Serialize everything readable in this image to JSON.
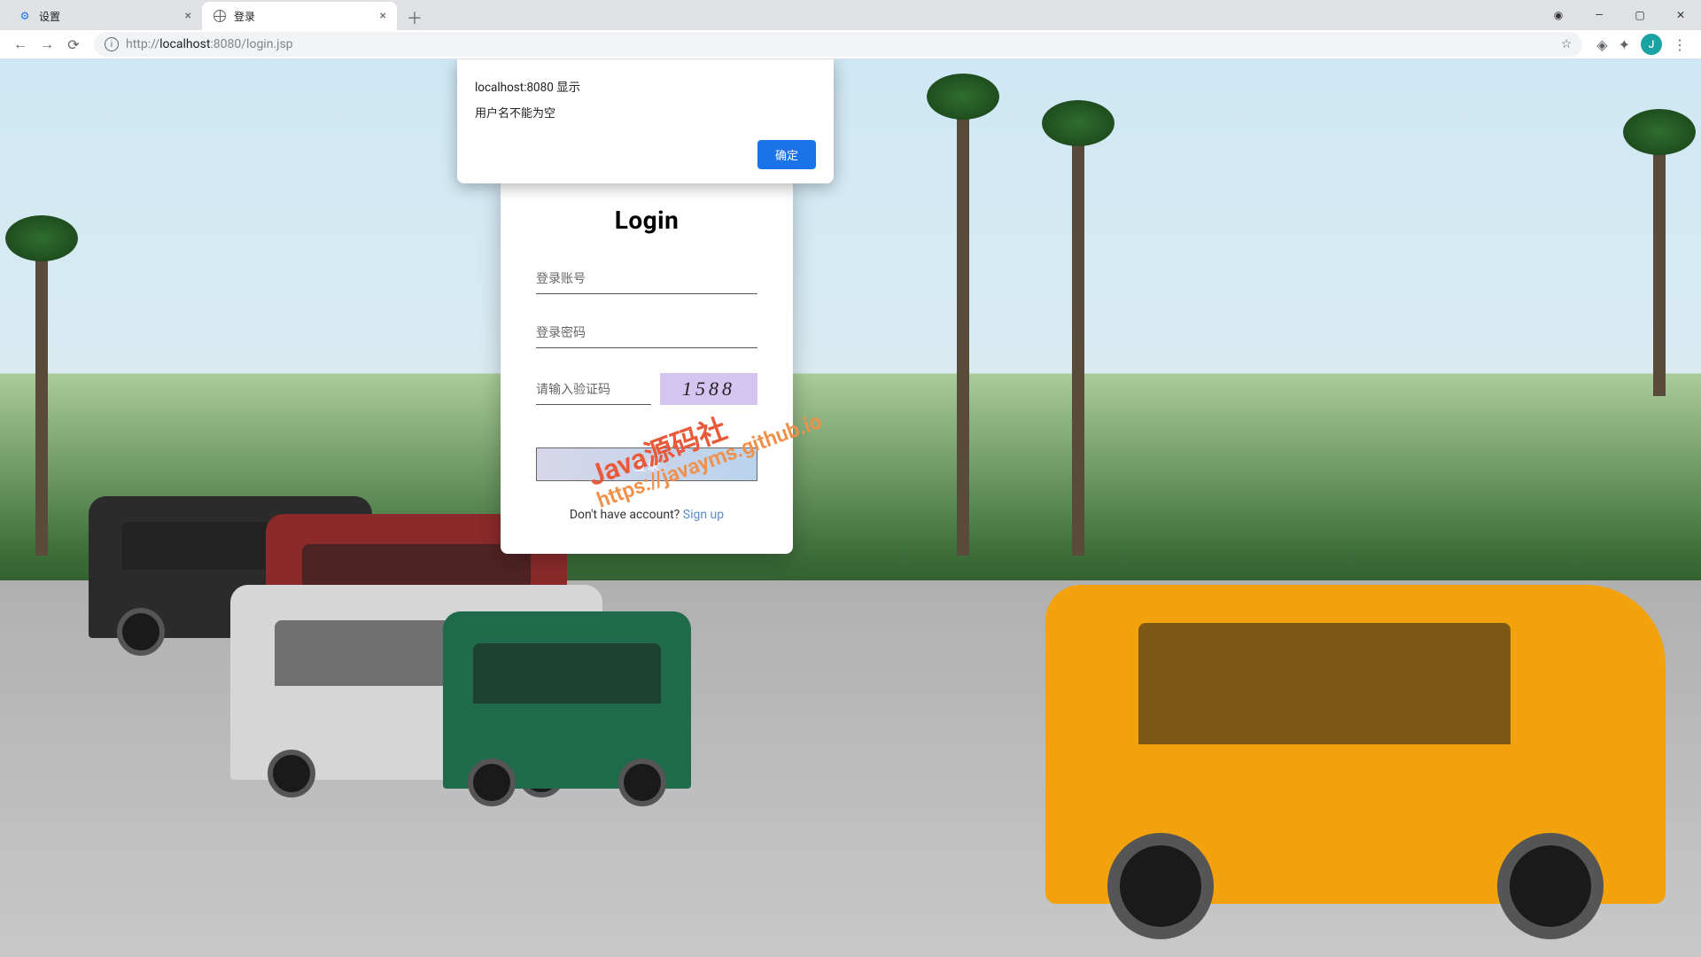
{
  "browser": {
    "tabs": [
      {
        "title": "设置",
        "active": false
      },
      {
        "title": "登录",
        "active": true
      }
    ],
    "url_scheme": "http://",
    "url_host": "localhost",
    "url_port": ":8080",
    "url_path": "/login.jsp",
    "avatar_initial": "J"
  },
  "alert": {
    "title": "localhost:8080 显示",
    "message": "用户名不能为空",
    "ok_label": "确定"
  },
  "login": {
    "title": "Login",
    "username_placeholder": "登录账号",
    "password_placeholder": "登录密码",
    "captcha_placeholder": "请输入验证码",
    "captcha_code": "1588",
    "submit_label": "登录",
    "signup_prompt": "Don't have account? ",
    "signup_link": "Sign up"
  },
  "watermark": {
    "line1": "Java源码社",
    "line2": "https://javayms.github.io"
  }
}
